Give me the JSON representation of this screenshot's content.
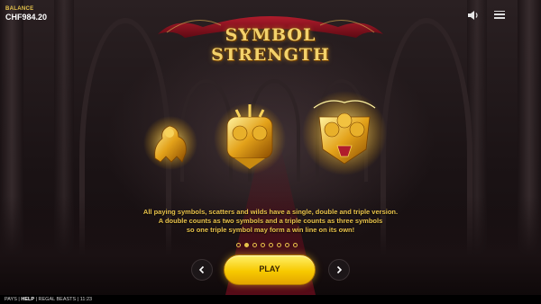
{
  "balance": {
    "label": "BALANCE",
    "value": "CHF984.20"
  },
  "title": {
    "line1": "SYMBOL",
    "line2": "STRENGTH"
  },
  "description": {
    "line1": "All paying symbols, scatters and wilds have a single, double and triple version.",
    "line2": "A double counts as two symbols and a triple counts as three symbols",
    "line3": "so one triple symbol may form a win line on its own!"
  },
  "pagination": {
    "total": 8,
    "active_index": 1
  },
  "play_label": "PLAY",
  "footer": {
    "pays": "PAYS",
    "separator": "|",
    "help": "HELP",
    "game_name": "REGAL BEASTS",
    "time": "11:23"
  },
  "icons": {
    "sound": "speaker-icon",
    "menu": "hamburger-menu-icon",
    "prev": "chevron-left-icon",
    "next": "chevron-right-icon"
  },
  "colors": {
    "accent_gold": "#e8c24a",
    "play_button": "#f7c900",
    "banner_red": "#8b1420"
  }
}
